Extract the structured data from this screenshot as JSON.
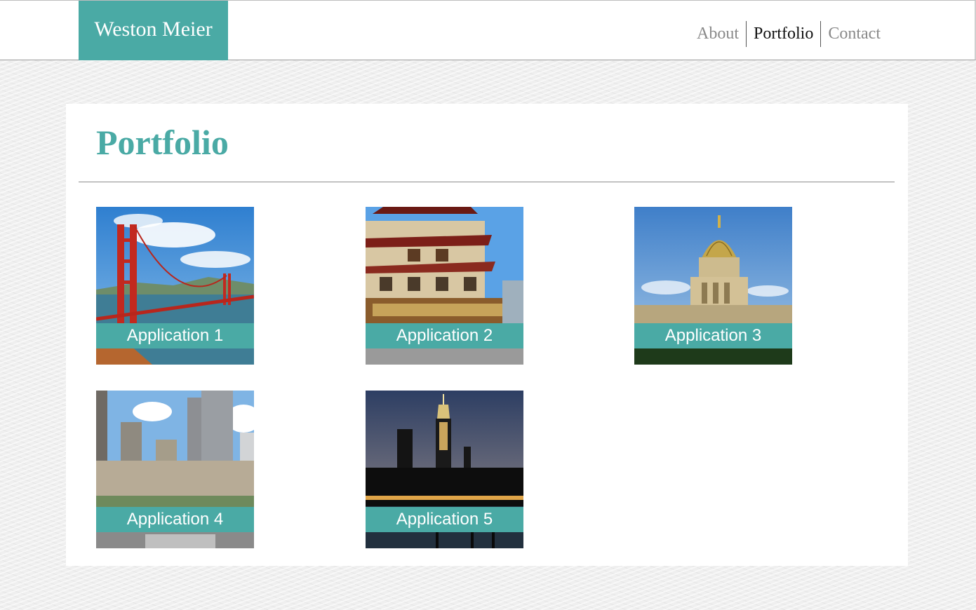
{
  "header": {
    "logo_text": "Weston Meier",
    "nav": [
      {
        "label": "About",
        "active": false
      },
      {
        "label": "Portfolio",
        "active": true
      },
      {
        "label": "Contact",
        "active": false
      }
    ]
  },
  "main": {
    "title": "Portfolio",
    "items": [
      {
        "label": "Application 1",
        "image": "golden-gate-bridge-photo"
      },
      {
        "label": "Application 2",
        "image": "chinatown-building-photo"
      },
      {
        "label": "Application 3",
        "image": "domed-palace-photo"
      },
      {
        "label": "Application 4",
        "image": "city-skyscrapers-photo"
      },
      {
        "label": "Application 5",
        "image": "night-skyline-photo"
      }
    ]
  },
  "colors": {
    "accent": "#4aaaa5",
    "nav_inactive": "#8a8a8a",
    "nav_active": "#111111",
    "page_background": "#efefef"
  }
}
